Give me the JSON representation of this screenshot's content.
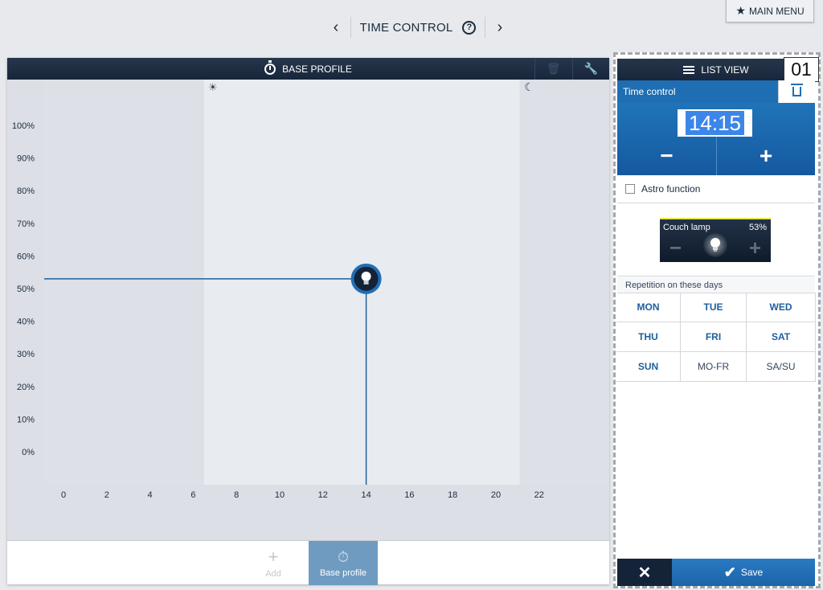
{
  "topnav": {
    "prev_arrow": "‹",
    "next_arrow": "›",
    "title": "TIME CONTROL",
    "help": "?"
  },
  "main_menu": {
    "label": "MAIN MENU",
    "icon": "star-icon"
  },
  "chart_panel": {
    "header_title": "BASE PROFILE",
    "header_icons": [
      "timer-icon",
      "trash-icon",
      "wrench-icon"
    ],
    "footer": {
      "add_label": "Add",
      "base_profile_label": "Base profile"
    }
  },
  "chart_data": {
    "type": "line",
    "title": "",
    "xlabel": "",
    "ylabel": "",
    "x_ticks": [
      0,
      2,
      4,
      6,
      8,
      10,
      12,
      14,
      16,
      18,
      20,
      22
    ],
    "y_ticks": [
      "100%",
      "90%",
      "80%",
      "70%",
      "60%",
      "50%",
      "40%",
      "30%",
      "20%",
      "10%",
      "0%"
    ],
    "xlim": [
      -1,
      25
    ],
    "ylim": [
      0,
      100
    ],
    "daylight": {
      "sunrise": 6.5,
      "sunset": 21.1
    },
    "point": {
      "x": 14,
      "y": 53
    },
    "icons": [
      "sun-icon",
      "moon-icon",
      "lightbulb-icon"
    ],
    "colors": {
      "line": "#1f5f9c",
      "day": "#e8ebf0",
      "night": "#dde0e6"
    }
  },
  "right_panel": {
    "badge": "01",
    "list_view_label": "LIST VIEW",
    "time_control_label": "Time control",
    "time_value": "14:15",
    "minus": "−",
    "plus": "+",
    "astro_label": "Astro function",
    "astro_checked": false,
    "lamp": {
      "name": "Couch lamp",
      "percent": "53%",
      "minus": "−",
      "plus": "+"
    },
    "repetition_label": "Repetition on these days",
    "days": [
      {
        "label": "MON",
        "selected": true
      },
      {
        "label": "TUE",
        "selected": true
      },
      {
        "label": "WED",
        "selected": true
      },
      {
        "label": "THU",
        "selected": true
      },
      {
        "label": "FRI",
        "selected": true
      },
      {
        "label": "SAT",
        "selected": true
      },
      {
        "label": "SUN",
        "selected": true
      },
      {
        "label": "MO-FR",
        "selected": false
      },
      {
        "label": "SA/SU",
        "selected": false
      }
    ],
    "cancel": "✕",
    "save_label": "Save"
  }
}
